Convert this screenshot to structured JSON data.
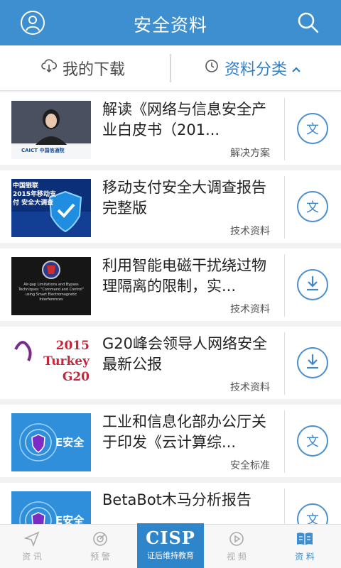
{
  "header": {
    "title": "安全资料"
  },
  "subbar": {
    "downloads_label": "我的下载",
    "categories_label": "资料分类"
  },
  "items": [
    {
      "title": "解读《网络与信息安全产业白皮书（201...",
      "category": "解决方案",
      "action": "文",
      "thumb_text": "CAICT 中国信通院"
    },
    {
      "title": "移动支付安全大调查报告完整版",
      "category": "技术资料",
      "action": "文",
      "thumb_text": "中国银联 2015年移动支付 安全大调查"
    },
    {
      "title": "利用智能电磁干扰绕过物理隔离的限制，实...",
      "category": "技术资料",
      "action": "download",
      "thumb_text": "Air-gap Limitations and Bypass Techniques: \"Command and Control\" using Smart Electromagnetic Interferences"
    },
    {
      "title": "G20峰会领导人网络安全最新公报",
      "category": "技术资料",
      "action": "download",
      "thumb_text": "2015 Turkey G20"
    },
    {
      "title": "工业和信息化部办公厅关于印发《云计算综...",
      "category": "安全标准",
      "action": "文",
      "thumb_text": "E安全"
    },
    {
      "title": "BetaBot木马分析报告",
      "category": "",
      "action": "文",
      "thumb_text": "E安全"
    }
  ],
  "bottom_nav": {
    "news": "资 讯",
    "alerts": "预 警",
    "cisp_big": "CISP",
    "cisp_small": "证后维持教育",
    "video": "视 频",
    "docs": "资 料"
  },
  "colors": {
    "primary": "#3d8fd0",
    "accent_text": "#2f7fc6"
  }
}
